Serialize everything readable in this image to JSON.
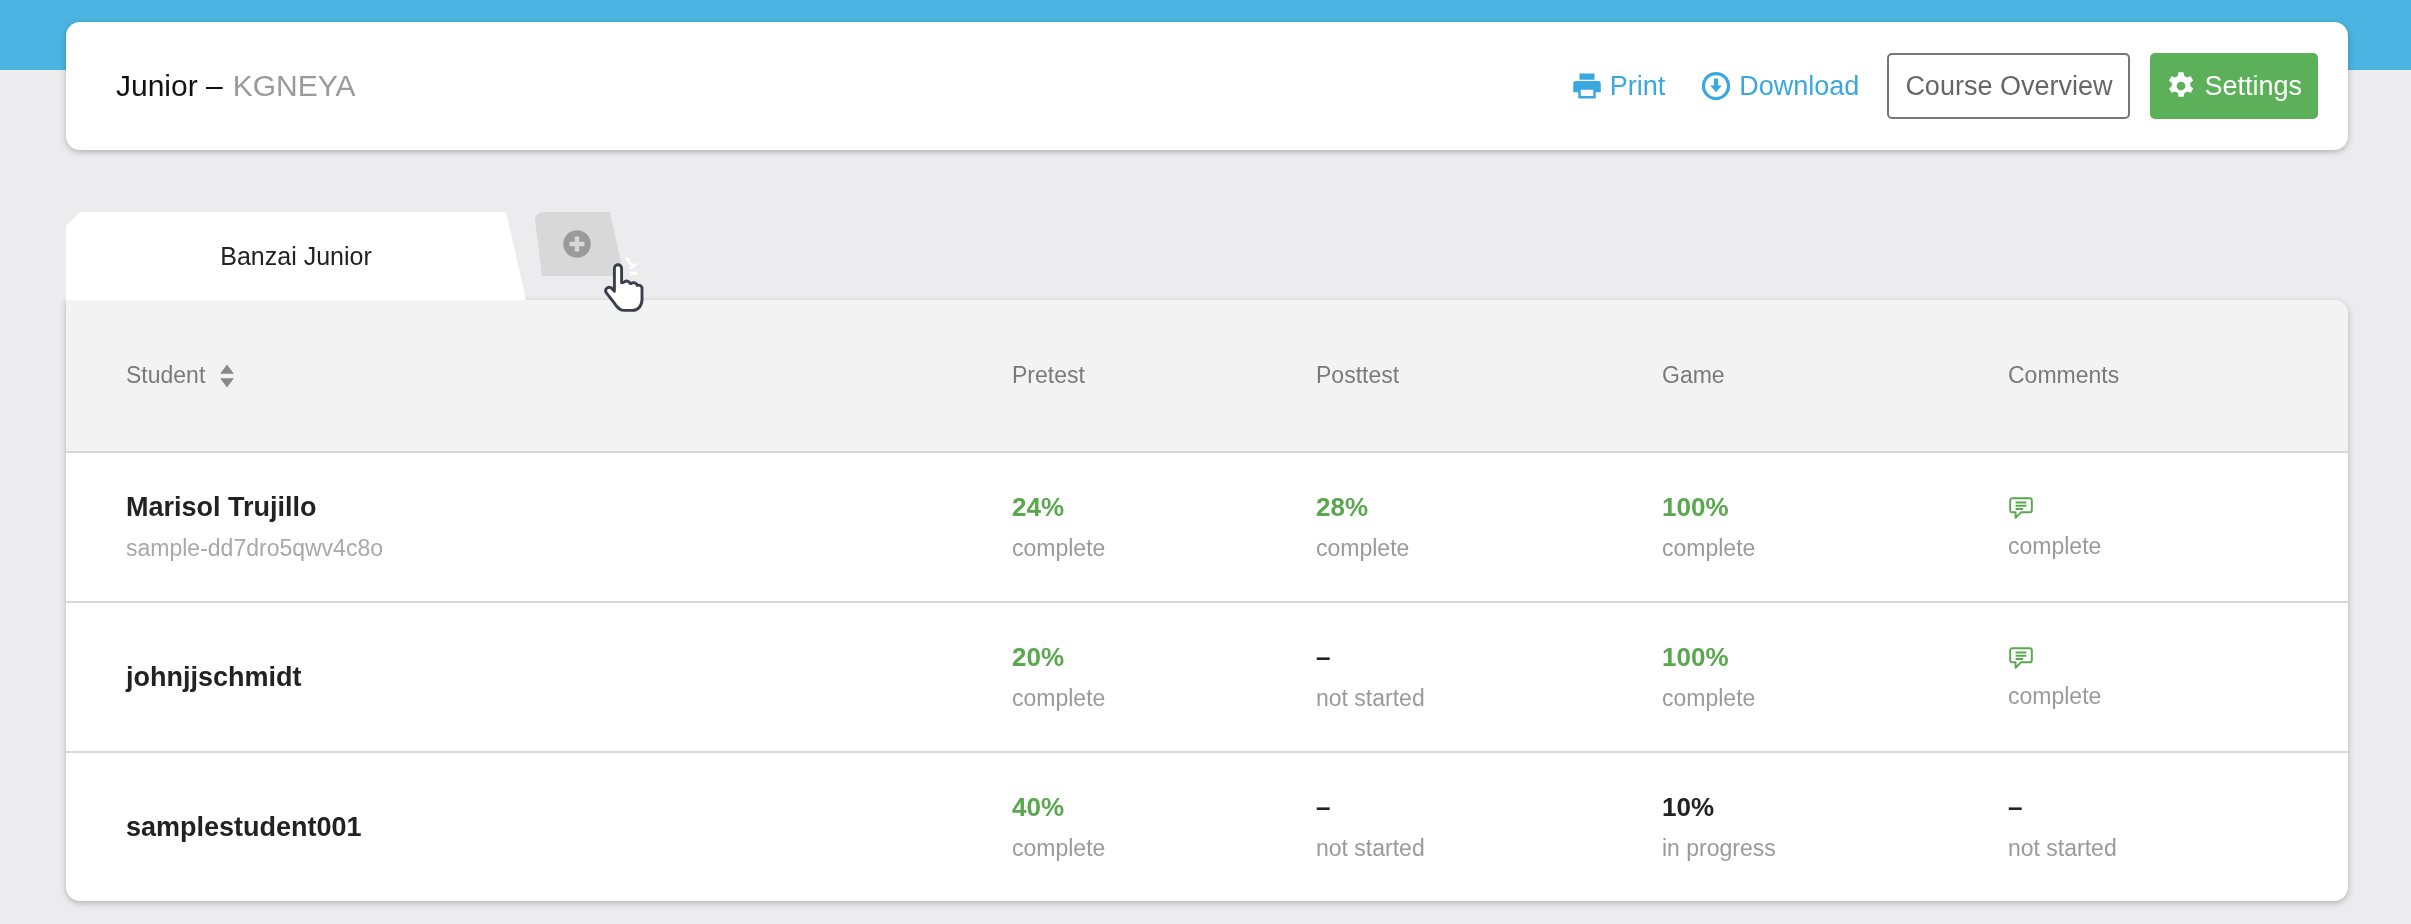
{
  "header": {
    "title": "Junior –",
    "code": "KGNEYA",
    "actions": [
      {
        "kind": "print",
        "label": "Print"
      },
      {
        "kind": "download",
        "label": "Download"
      },
      {
        "kind": "outline",
        "label": "Course Overview"
      },
      {
        "kind": "settings",
        "label": "Settings"
      }
    ]
  },
  "tabs": [
    {
      "label": "Banzai Junior",
      "selected": true
    }
  ],
  "table": {
    "columns": [
      {
        "label": "Student"
      },
      {
        "label": "Pretest"
      },
      {
        "label": "Posttest"
      },
      {
        "label": "Game"
      },
      {
        "label": "Comments"
      }
    ],
    "rows": [
      {
        "cells": [
          {
            "kind": "student",
            "name": "Marisol Trujillo",
            "id": "sample-dd7dro5qwv4c8o"
          },
          {
            "kind": "score",
            "value": "24%",
            "done": true,
            "status": "complete"
          },
          {
            "kind": "score",
            "value": "28%",
            "done": true,
            "status": "complete"
          },
          {
            "kind": "score",
            "value": "100%",
            "done": true,
            "status": "complete"
          },
          {
            "kind": "comment",
            "status": "complete"
          }
        ]
      },
      {
        "cells": [
          {
            "kind": "student",
            "name": "johnjjschmidt"
          },
          {
            "kind": "score",
            "value": "20%",
            "done": true,
            "status": "complete"
          },
          {
            "kind": "score",
            "value": "–",
            "done": false,
            "status": "not started"
          },
          {
            "kind": "score",
            "value": "100%",
            "done": true,
            "status": "complete"
          },
          {
            "kind": "comment",
            "status": "complete"
          }
        ]
      },
      {
        "cells": [
          {
            "kind": "student",
            "name": "samplestudent001"
          },
          {
            "kind": "score",
            "value": "40%",
            "done": true,
            "status": "complete"
          },
          {
            "kind": "score",
            "value": "–",
            "done": false,
            "status": "not started"
          },
          {
            "kind": "score",
            "value": "10%",
            "done": false,
            "status": "in progress"
          },
          {
            "kind": "score",
            "value": "–",
            "done": false,
            "status": "not started"
          }
        ]
      }
    ]
  }
}
